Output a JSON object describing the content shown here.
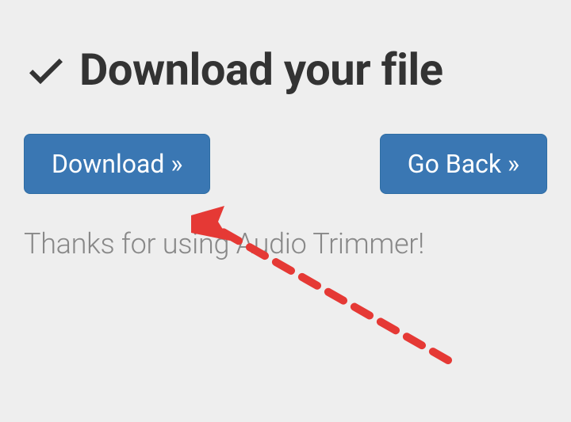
{
  "heading": {
    "title": "Download your file"
  },
  "buttons": {
    "download_label": "Download »",
    "goback_label": "Go Back »"
  },
  "footer": {
    "thanks_text": "Thanks for using Audio Trimmer!"
  },
  "colors": {
    "button_bg": "#3a77b3",
    "arrow": "#e53935",
    "heading": "#333333",
    "muted": "#888888",
    "page_bg": "#eeeeee"
  }
}
